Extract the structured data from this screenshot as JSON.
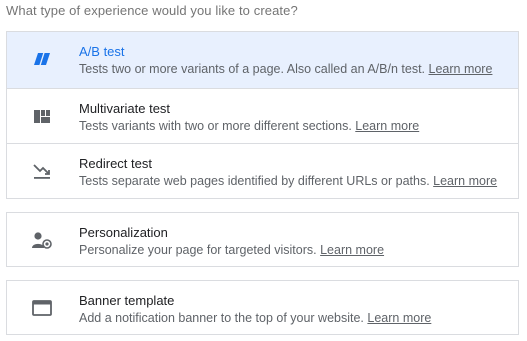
{
  "prompt": "What type of experience would you like to create?",
  "learn_more_label": "Learn more",
  "colors": {
    "selected_bg": "#e8f0fe",
    "selected_accent": "#1a73e8",
    "icon_gray": "#5f6368",
    "border": "#dadce0"
  },
  "experiments": [
    {
      "icon": "ab-test-icon",
      "title": "A/B test",
      "description": "Tests two or more variants of a page. Also called an A/B/n test.",
      "selected": true
    },
    {
      "icon": "multivariate-grid-icon",
      "title": "Multivariate test",
      "description": "Tests variants with two or more different sections.",
      "selected": false
    },
    {
      "icon": "redirect-arrow-icon",
      "title": "Redirect test",
      "description": "Tests separate web pages identified by different URLs or paths.",
      "selected": false
    }
  ],
  "personalization": {
    "icon": "person-target-icon",
    "title": "Personalization",
    "description": "Personalize your page for targeted visitors."
  },
  "banner": {
    "icon": "banner-window-icon",
    "title": "Banner template",
    "description": "Add a notification banner to the top of your website."
  }
}
